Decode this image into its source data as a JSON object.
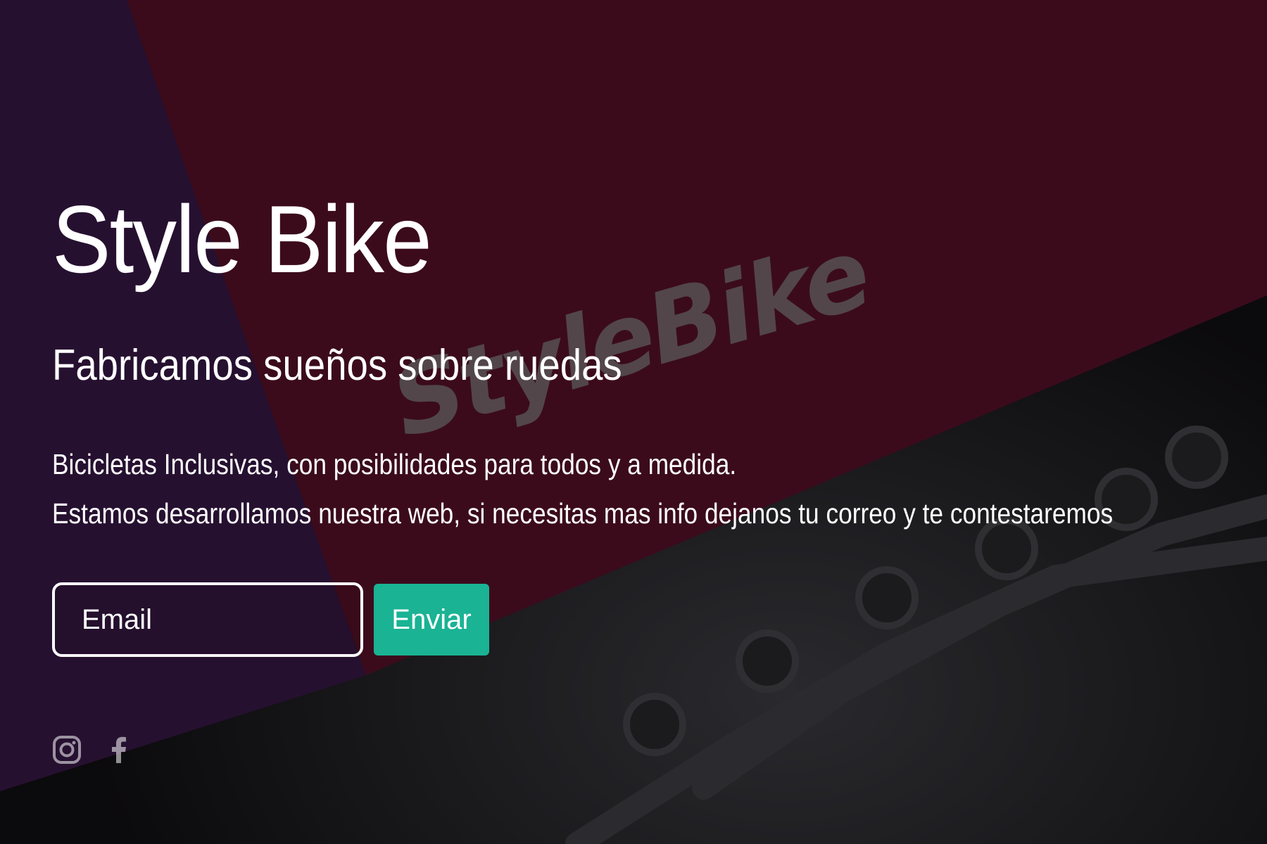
{
  "hero": {
    "title": "Style Bike",
    "subtitle": "Fabricamos sueños sobre ruedas",
    "description_lines": [
      "Bicicletas Inclusivas, con posibilidades para todos y a medida.",
      "Estamos desarrollamos nuestra web, si necesitas mas info dejanos tu correo y te contestaremos"
    ]
  },
  "form": {
    "email_placeholder": "Email",
    "submit_label": "Enviar"
  },
  "watermark": {
    "text": "StyleBike"
  },
  "social": [
    {
      "name": "instagram",
      "icon": "instagram-icon"
    },
    {
      "name": "facebook",
      "icon": "facebook-icon"
    }
  ],
  "colors": {
    "accent": "#1ab394",
    "purple_panel": "#261030",
    "maroon_panel": "#3b0b1c",
    "dark_base": "#0b0a0c",
    "text": "#ffffff",
    "watermark": "#5a5a5a"
  }
}
